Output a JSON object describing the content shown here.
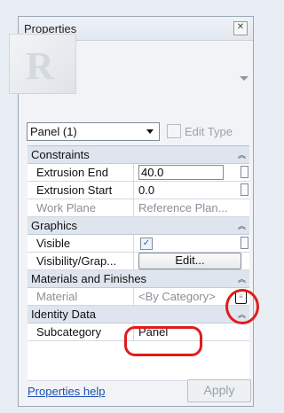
{
  "window": {
    "title": "Properties"
  },
  "type_selector": {
    "value": "Panel (1)",
    "edit_type_label": "Edit Type"
  },
  "sections": {
    "constraints": {
      "label": "Constraints",
      "rows": {
        "extrusion_end": {
          "label": "Extrusion End",
          "value": "40.0"
        },
        "extrusion_start": {
          "label": "Extrusion Start",
          "value": "0.0"
        },
        "work_plane": {
          "label": "Work Plane",
          "value": "Reference Plan..."
        }
      }
    },
    "graphics": {
      "label": "Graphics",
      "rows": {
        "visible": {
          "label": "Visible",
          "checked": true
        },
        "visibility": {
          "label": "Visibility/Grap...",
          "button": "Edit..."
        }
      }
    },
    "materials": {
      "label": "Materials and Finishes",
      "rows": {
        "material": {
          "label": "Material",
          "value": "<By Category>"
        }
      }
    },
    "identity": {
      "label": "Identity Data",
      "rows": {
        "subcategory": {
          "label": "Subcategory",
          "value": "Panel"
        }
      }
    }
  },
  "footer": {
    "help_link": "Properties help",
    "apply": "Apply"
  },
  "icons": {
    "collapse": "chevron-up-icon",
    "close": "close-icon",
    "browse": "browse-icon"
  },
  "colors": {
    "annotation": "#e21b1b",
    "link": "#1f4fb5"
  }
}
